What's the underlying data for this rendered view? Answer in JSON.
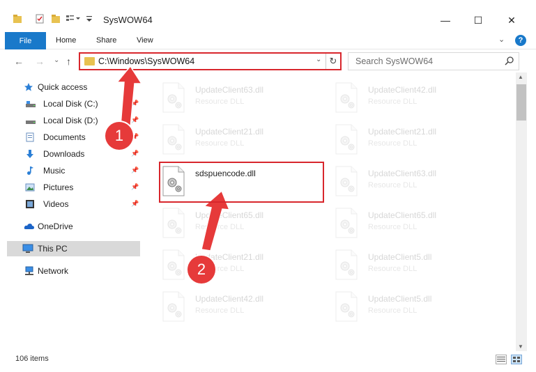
{
  "window": {
    "title": "SysWOW64",
    "minimize_glyph": "—",
    "maximize_glyph": "☐",
    "close_glyph": "✕"
  },
  "ribbon": {
    "tabs": [
      "File",
      "Home",
      "Share",
      "View"
    ],
    "help_glyph": "?",
    "collapse_glyph": "⌄"
  },
  "address": {
    "path": "C:\\Windows\\SysWOW64",
    "dropdown_glyph": "⌄",
    "refresh_glyph": "↻"
  },
  "nav_buttons": {
    "back": "←",
    "forward": "→",
    "recent": "⌄",
    "up": "↑"
  },
  "search": {
    "placeholder": "Search SysWOW64",
    "icon": "search-icon"
  },
  "navpane": {
    "quick_access": "Quick access",
    "items": [
      {
        "label": "Local Disk (C:)",
        "icon": "drive-icon",
        "pinned": true
      },
      {
        "label": "Local Disk (D:)",
        "icon": "drive-icon",
        "pinned": true
      },
      {
        "label": "Documents",
        "icon": "documents-icon",
        "pinned": true
      },
      {
        "label": "Downloads",
        "icon": "downloads-icon",
        "pinned": true
      },
      {
        "label": "Music",
        "icon": "music-icon",
        "pinned": true
      },
      {
        "label": "Pictures",
        "icon": "pictures-icon",
        "pinned": true
      },
      {
        "label": "Videos",
        "icon": "videos-icon",
        "pinned": true
      }
    ],
    "onedrive": "OneDrive",
    "this_pc": "This PC",
    "network": "Network"
  },
  "files": {
    "left": [
      {
        "name": "UpdateClient63.dll",
        "type": "Resource DLL"
      },
      {
        "name": "UpdateClient21.dll",
        "type": "Resource DLL"
      },
      {
        "name": "sdspuencode.dll",
        "type": ""
      },
      {
        "name": "UpdateClient65.dll",
        "type": "Resource DLL"
      },
      {
        "name": "UpdateClient21.dll",
        "type": "Resource DLL"
      },
      {
        "name": "UpdateClient42.dll",
        "type": "Resource DLL"
      }
    ],
    "right": [
      {
        "name": "UpdateClient42.dll",
        "type": "Resource DLL"
      },
      {
        "name": "UpdateClient21.dll",
        "type": "Resource DLL"
      },
      {
        "name": "UpdateClient63.dll",
        "type": "Resource DLL"
      },
      {
        "name": "UpdateClient65.dll",
        "type": "Resource DLL"
      },
      {
        "name": "UpdateClient5.dll",
        "type": "Resource DLL"
      },
      {
        "name": "UpdateClient5.dll",
        "type": "Resource DLL"
      }
    ]
  },
  "status": {
    "item_count": "106 items"
  },
  "annotations": {
    "step1": "1",
    "step2": "2",
    "color": "#d8262c"
  }
}
